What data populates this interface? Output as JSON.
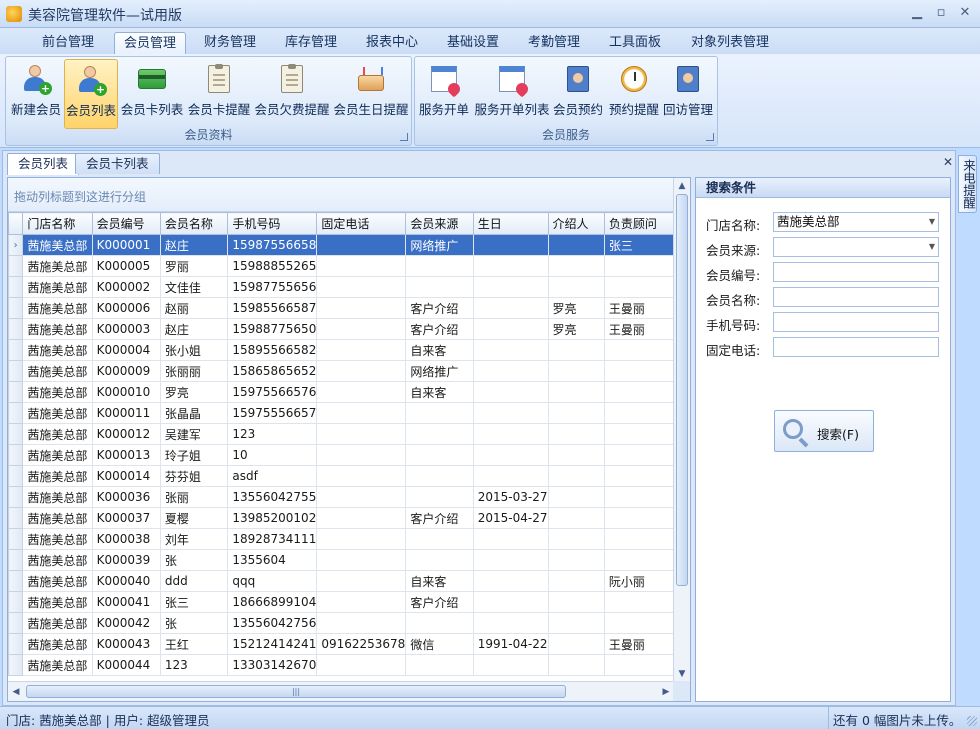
{
  "window": {
    "title": "美容院管理软件—试用版"
  },
  "ribbon": {
    "tabs": [
      "前台管理",
      "会员管理",
      "财务管理",
      "库存管理",
      "报表中心",
      "基础设置",
      "考勤管理",
      "工具面板",
      "对象列表管理"
    ],
    "active_tab": "会员管理",
    "groups": [
      {
        "label": "会员资料",
        "buttons": [
          {
            "label": "新建会员",
            "icon": "add-member-icon"
          },
          {
            "label": "会员列表",
            "icon": "member-list-icon"
          },
          {
            "label": "会员卡列表",
            "icon": "member-card-icon"
          },
          {
            "label": "会员卡提醒",
            "icon": "card-reminder-icon"
          },
          {
            "label": "会员欠费提醒",
            "icon": "arrears-reminder-icon"
          },
          {
            "label": "会员生日提醒",
            "icon": "birthday-cake-icon"
          }
        ]
      },
      {
        "label": "会员服务",
        "buttons": [
          {
            "label": "服务开单",
            "icon": "service-order-icon"
          },
          {
            "label": "服务开单列表",
            "icon": "service-order-list-icon"
          },
          {
            "label": "会员预约",
            "icon": "appointment-icon"
          },
          {
            "label": "预约提醒",
            "icon": "alarm-clock-icon"
          },
          {
            "label": "回访管理",
            "icon": "follow-up-icon"
          }
        ]
      }
    ]
  },
  "subtabs": [
    "会员列表",
    "会员卡列表"
  ],
  "grid": {
    "group_hint": "拖动列标题到这进行分组",
    "columns": [
      "门店名称",
      "会员编号",
      "会员名称",
      "手机号码",
      "固定电话",
      "会员来源",
      "生日",
      "介绍人",
      "负责顾问"
    ],
    "rows": [
      [
        "茜施美总部",
        "K000001",
        "赵庄",
        "15987556658",
        "",
        "网络推广",
        "",
        "",
        "张三"
      ],
      [
        "茜施美总部",
        "K000005",
        "罗丽",
        "15988855265",
        "",
        "",
        "",
        "",
        ""
      ],
      [
        "茜施美总部",
        "K000002",
        "文佳佳",
        "15987755656",
        "",
        "",
        "",
        "",
        ""
      ],
      [
        "茜施美总部",
        "K000006",
        "赵丽",
        "15985566587",
        "",
        "客户介绍",
        "",
        "罗亮",
        "王曼丽"
      ],
      [
        "茜施美总部",
        "K000003",
        "赵庄",
        "15988775650",
        "",
        "客户介绍",
        "",
        "罗亮",
        "王曼丽"
      ],
      [
        "茜施美总部",
        "K000004",
        "张小姐",
        "15895566582",
        "",
        "自来客",
        "",
        "",
        ""
      ],
      [
        "茜施美总部",
        "K000009",
        "张丽丽",
        "15865865652",
        "",
        "网络推广",
        "",
        "",
        ""
      ],
      [
        "茜施美总部",
        "K000010",
        "罗亮",
        "15975566576",
        "",
        "自来客",
        "",
        "",
        ""
      ],
      [
        "茜施美总部",
        "K000011",
        "张晶晶",
        "15975556657",
        "",
        "",
        "",
        "",
        ""
      ],
      [
        "茜施美总部",
        "K000012",
        "吴建军",
        "123",
        "",
        "",
        "",
        "",
        ""
      ],
      [
        "茜施美总部",
        "K000013",
        "玲子姐",
        "10",
        "",
        "",
        "",
        "",
        ""
      ],
      [
        "茜施美总部",
        "K000014",
        "芬芬姐",
        "asdf",
        "",
        "",
        "",
        "",
        ""
      ],
      [
        "茜施美总部",
        "K000036",
        "张丽",
        "13556042755",
        "",
        "",
        "2015-03-27",
        "",
        ""
      ],
      [
        "茜施美总部",
        "K000037",
        "夏樱",
        "13985200102",
        "",
        "客户介绍",
        "2015-04-27",
        "",
        ""
      ],
      [
        "茜施美总部",
        "K000038",
        "刘年",
        "18928734111",
        "",
        "",
        "",
        "",
        ""
      ],
      [
        "茜施美总部",
        "K000039",
        "张",
        "1355604",
        "",
        "",
        "",
        "",
        ""
      ],
      [
        "茜施美总部",
        "K000040",
        "ddd",
        "qqq",
        "",
        "自来客",
        "",
        "",
        "阮小丽"
      ],
      [
        "茜施美总部",
        "K000041",
        "张三",
        "18666899104",
        "",
        "客户介绍",
        "",
        "",
        ""
      ],
      [
        "茜施美总部",
        "K000042",
        "张",
        "13556042756",
        "",
        "",
        "",
        "",
        ""
      ],
      [
        "茜施美总部",
        "K000043",
        "王红",
        "15212414241",
        "09162253678",
        "微信",
        "1991-04-22",
        "",
        "王曼丽"
      ],
      [
        "茜施美总部",
        "K000044",
        "123",
        "13303142670",
        "",
        "",
        "",
        "",
        ""
      ]
    ]
  },
  "search": {
    "title": "搜索条件",
    "fields": [
      {
        "label": "门店名称:",
        "value": "茜施美总部",
        "dropdown": true
      },
      {
        "label": "会员来源:",
        "value": "",
        "dropdown": true
      },
      {
        "label": "会员编号:",
        "value": "",
        "dropdown": false
      },
      {
        "label": "会员名称:",
        "value": "",
        "dropdown": false
      },
      {
        "label": "手机号码:",
        "value": "",
        "dropdown": false
      },
      {
        "label": "固定电话:",
        "value": "",
        "dropdown": false
      }
    ],
    "button_label": "搜索(F)"
  },
  "side_tab": "来电提醒",
  "status": {
    "left": "门店: 茜施美总部 | 用户: 超级管理员",
    "right": "还有 0 幅图片未上传。"
  }
}
